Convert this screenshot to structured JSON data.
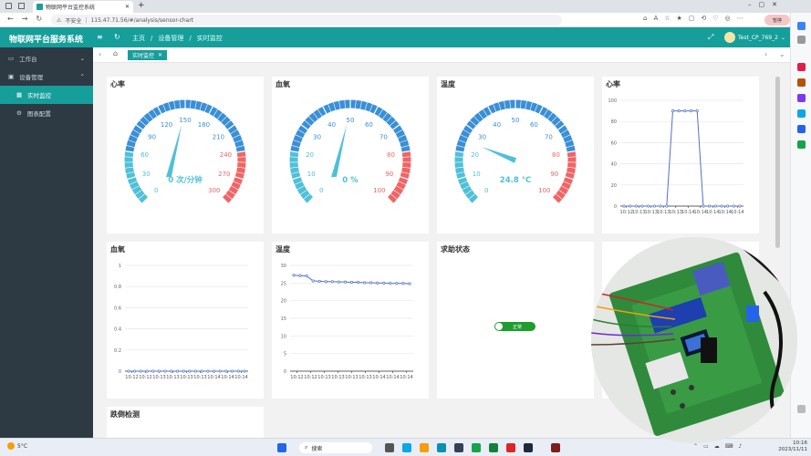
{
  "browser": {
    "tab_title": "物联网平台监控系统",
    "insecure_label": "不安全",
    "url": "115.47.71.56/#/analysis/sensor-chart",
    "profile": "暂停"
  },
  "app": {
    "brand": "物联网平台服务系统",
    "crumbs": [
      "主页",
      "设备管理",
      "实时监控"
    ],
    "user": "Test_CP_769_2"
  },
  "sidebar": {
    "items": [
      {
        "label": "工作台"
      },
      {
        "label": "设备管理"
      },
      {
        "label": "实时监控"
      },
      {
        "label": "图表配置"
      }
    ]
  },
  "tags": {
    "active": "实时监控"
  },
  "cards": {
    "hr_gauge": {
      "title": "心率",
      "value_text": "0 次/分钟",
      "value": 0,
      "min": 0,
      "max": 300,
      "ticks": [
        "0",
        "30",
        "60",
        "90",
        "120",
        "150",
        "180",
        "210",
        "240",
        "270",
        "300"
      ]
    },
    "spo2_gauge": {
      "title": "血氧",
      "value_text": "0 %",
      "value": 0,
      "min": 0,
      "max": 100,
      "ticks": [
        "0",
        "10",
        "20",
        "30",
        "40",
        "50",
        "60",
        "70",
        "80",
        "90",
        "100"
      ]
    },
    "temp_gauge": {
      "title": "温度",
      "value_text": "24.8 °C",
      "value": 24.8,
      "min": 0,
      "max": 100,
      "ticks": [
        "0",
        "10",
        "20",
        "30",
        "40",
        "50",
        "60",
        "70",
        "80",
        "90",
        "100"
      ]
    },
    "hr_line": {
      "title": "心率"
    },
    "spo2_line": {
      "title": "血氧"
    },
    "temp_line": {
      "title": "温度"
    },
    "help": {
      "title": "求助状态",
      "toggle_label": "正常"
    },
    "fall": {
      "title": "跌倒检测"
    }
  },
  "chart_data": [
    {
      "type": "line",
      "title": "心率",
      "x": [
        "10:12",
        "10:13",
        "10:13",
        "10:13",
        "10:13",
        "10:14",
        "10:14",
        "10:14",
        "10:14",
        "10:14"
      ],
      "y": [
        0,
        0,
        0,
        0,
        0,
        0,
        0,
        0,
        90,
        90,
        90,
        90,
        90,
        0,
        0,
        0,
        0,
        0,
        0,
        0
      ],
      "ylim": [
        0,
        100
      ],
      "yticks": [
        "0",
        "20",
        "40",
        "60",
        "80",
        "100"
      ]
    },
    {
      "type": "line",
      "title": "血氧",
      "x": [
        "10:12",
        "10:12",
        "10:13",
        "10:13",
        "10:13",
        "10:13",
        "10:14",
        "10:14",
        "10:14"
      ],
      "y": [
        0,
        0,
        0,
        0,
        0,
        0,
        0,
        0,
        0,
        0,
        0,
        0,
        0,
        0,
        0,
        0,
        0,
        0,
        0,
        0
      ],
      "ylim": [
        0,
        1
      ],
      "yticks": [
        "0",
        "0.2",
        "0.4",
        "0.6",
        "0.8",
        "1"
      ]
    },
    {
      "type": "line",
      "title": "温度",
      "x": [
        "10:12",
        "10:12",
        "10:13",
        "10:13",
        "10:13",
        "10:13",
        "10:14",
        "10:14",
        "10:14"
      ],
      "y": [
        27.2,
        27.1,
        27.0,
        25.6,
        25.5,
        25.4,
        25.4,
        25.3,
        25.3,
        25.2,
        25.2,
        25.1,
        25.1,
        25.0,
        25.0,
        24.9,
        24.9,
        24.9,
        24.8
      ],
      "ylim": [
        0,
        30
      ],
      "yticks": [
        "0",
        "5",
        "10",
        "15",
        "20",
        "25",
        "30"
      ]
    }
  ],
  "taskbar": {
    "weather": "5°C",
    "search": "搜索",
    "time": "10:16",
    "date": "2023/11/11"
  },
  "colors": {
    "teal": "#169e9a",
    "sidebar": "#2d3a44",
    "line": "#5470c6",
    "gauge_low": "#4fc0d8",
    "gauge_mid": "#3a8fd6",
    "gauge_high": "#ef6566"
  }
}
